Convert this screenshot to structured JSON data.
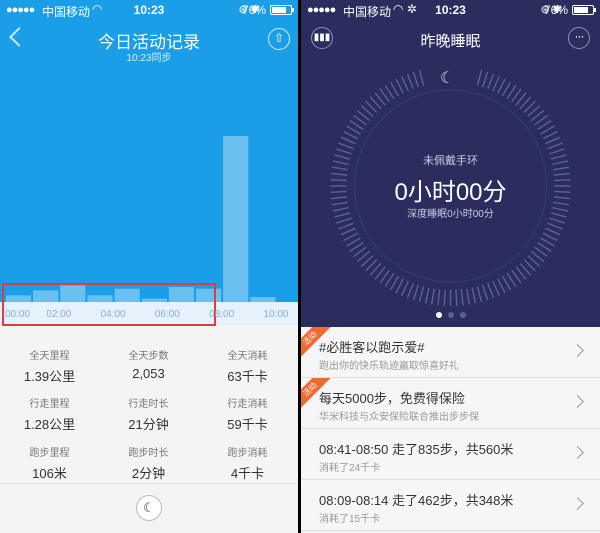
{
  "status_bar": {
    "signal_dots": "●●●●●",
    "carrier": "中国移动",
    "time": "10:23",
    "battery_pct": "76%",
    "battery_level": 0.76
  },
  "activity": {
    "title": "今日活动记录",
    "sync_note": "10:23同步",
    "chart_data": {
      "type": "bar",
      "x_ticks": [
        "00:00",
        "02:00",
        "04:00",
        "06:00",
        "08:00",
        "10:00"
      ],
      "xlim": [
        0,
        10.5
      ],
      "ylim": [
        0,
        100
      ],
      "bars": [
        {
          "start": 0.0,
          "end": 1.0,
          "value": 4
        },
        {
          "start": 1.0,
          "end": 2.0,
          "value": 7
        },
        {
          "start": 2.0,
          "end": 3.0,
          "value": 10
        },
        {
          "start": 3.0,
          "end": 4.0,
          "value": 4
        },
        {
          "start": 4.0,
          "end": 5.0,
          "value": 8
        },
        {
          "start": 5.0,
          "end": 6.0,
          "value": 2
        },
        {
          "start": 6.0,
          "end": 7.0,
          "value": 9
        },
        {
          "start": 7.0,
          "end": 8.0,
          "value": 8
        },
        {
          "start": 8.0,
          "end": 9.0,
          "value": 100
        },
        {
          "start": 9.0,
          "end": 10.0,
          "value": 3
        }
      ]
    },
    "stats": [
      {
        "label": "全天里程",
        "value": "1.39公里"
      },
      {
        "label": "全天步数",
        "value": "2,053"
      },
      {
        "label": "全天消耗",
        "value": "63千卡"
      },
      {
        "label": "行走里程",
        "value": "1.28公里"
      },
      {
        "label": "行走时长",
        "value": "21分钟"
      },
      {
        "label": "行走消耗",
        "value": "59千卡"
      },
      {
        "label": "跑步里程",
        "value": "106米"
      },
      {
        "label": "跑步时长",
        "value": "2分钟"
      },
      {
        "label": "跑步消耗",
        "value": "4千卡"
      }
    ]
  },
  "sleep": {
    "title": "昨晚睡眠",
    "status_text": "未佩戴手环",
    "total": "0小时00分",
    "deep": "深度睡眠0小时00分",
    "page_count": 3,
    "active_page": 0,
    "items": [
      {
        "badge": "活动",
        "title": "#必胜客以跑示爱#",
        "subtitle": "跑出你的快乐轨迹赢取惊喜好礼"
      },
      {
        "badge": "活动",
        "title": "每天5000步，免费得保险",
        "subtitle": "华米科技与众安保险联合推出步步保"
      },
      {
        "badge": "",
        "title": "08:41-08:50 走了835步，共560米",
        "subtitle": "消耗了24千卡"
      },
      {
        "badge": "",
        "title": "08:09-08:14 走了462步，共348米",
        "subtitle": "消耗了15千卡"
      }
    ]
  },
  "colors": {
    "activity_bg": "#1a9ee8",
    "bar": "#6cc0f0",
    "sleep_bg": "#2a2d5e",
    "badge": "#f26a2e",
    "highlight": "#e23b3b"
  }
}
